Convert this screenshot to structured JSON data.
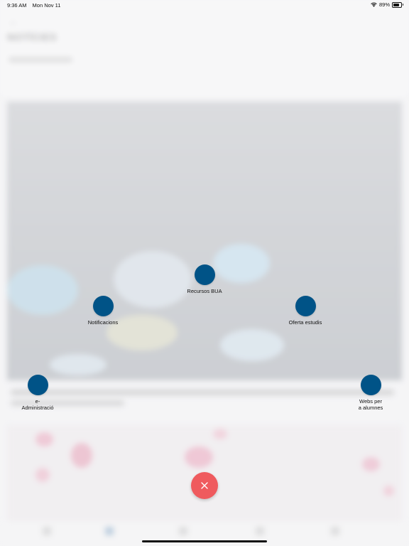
{
  "status_bar": {
    "time": "9:36 AM",
    "date": "Mon Nov 11",
    "battery": "89%",
    "icons": [
      "wifi-icon",
      "battery-icon"
    ]
  },
  "background_app": {
    "title": "NOTÍCIES"
  },
  "menu": {
    "items": [
      {
        "id": "recursos",
        "label": "Recursos BUA"
      },
      {
        "id": "notificacions",
        "label": "Notificacions"
      },
      {
        "id": "oferta",
        "label": "Oferta estudis"
      },
      {
        "id": "eadmin",
        "label": "e-\nAdministració"
      },
      {
        "id": "webs",
        "label": "Webs per\na alumnes"
      }
    ],
    "item_color": "#005387",
    "close_icon": "close-icon",
    "close_color": "#EF5A5E"
  }
}
